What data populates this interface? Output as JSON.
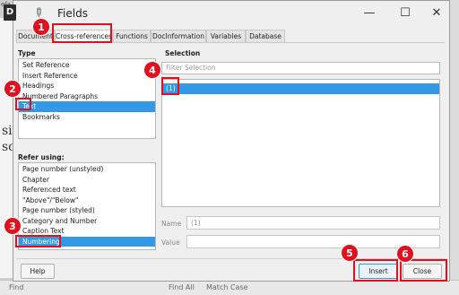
{
  "window": {
    "title": "Fields",
    "app_icon_glyph": "D",
    "controls": {
      "minimize": "—",
      "maximize": "☐",
      "close": "✕"
    }
  },
  "tabs": [
    {
      "label": "Document",
      "active": false
    },
    {
      "label": "Cross-references",
      "active": true
    },
    {
      "label": "Functions",
      "active": false
    },
    {
      "label": "DocInformation",
      "active": false
    },
    {
      "label": "Variables",
      "active": false
    },
    {
      "label": "Database",
      "active": false
    }
  ],
  "type_section": {
    "label": "Type",
    "items": [
      "Set Reference",
      "Insert Reference",
      "Headings",
      "Numbered Paragraphs",
      "Text",
      "Bookmarks"
    ],
    "selected": "Text"
  },
  "refer_section": {
    "label": "Refer using:",
    "items": [
      "Page number (unstyled)",
      "Chapter",
      "Referenced text",
      "\"Above\"/\"Below\"",
      "Page number (styled)",
      "Category and Number",
      "Caption Text",
      "Numbering"
    ],
    "selected": "Numbering"
  },
  "selection_section": {
    "label": "Selection",
    "filter_placeholder": "Filter Selection",
    "items": [
      "(1)"
    ],
    "selected": "(1)"
  },
  "name_field": {
    "label": "Name",
    "value": "(1)"
  },
  "value_field": {
    "label": "Value",
    "value": ""
  },
  "buttons": {
    "help": "Help",
    "insert": "Insert",
    "close": "Close"
  },
  "background": {
    "top_text": "efa",
    "doc_lines": [
      "si",
      "sc"
    ],
    "bottom_bar": {
      "find": "Find",
      "find_all": "Find All",
      "match_case": "Match Case"
    }
  },
  "annotations": [
    "1",
    "2",
    "3",
    "4",
    "5",
    "6"
  ],
  "colors": {
    "highlight": "#e0101e",
    "selection": "#3399e6"
  }
}
